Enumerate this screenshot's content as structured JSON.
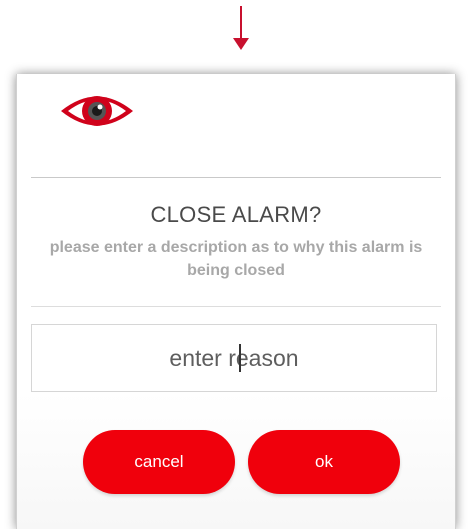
{
  "dialog": {
    "title": "CLOSE ALARM?",
    "subtitle": "please enter a description as to why this alarm is being closed",
    "reason_input": {
      "placeholder": "enter reason",
      "value": ""
    },
    "cancel_label": "cancel",
    "ok_label": "ok"
  },
  "icons": {
    "indicator": "down-arrow-icon",
    "logo": "eye-icon"
  },
  "colors": {
    "accent": "#f0000c",
    "logo_red": "#d0021b",
    "title": "#4a4a4a",
    "subtitle": "#a8a8a8"
  }
}
